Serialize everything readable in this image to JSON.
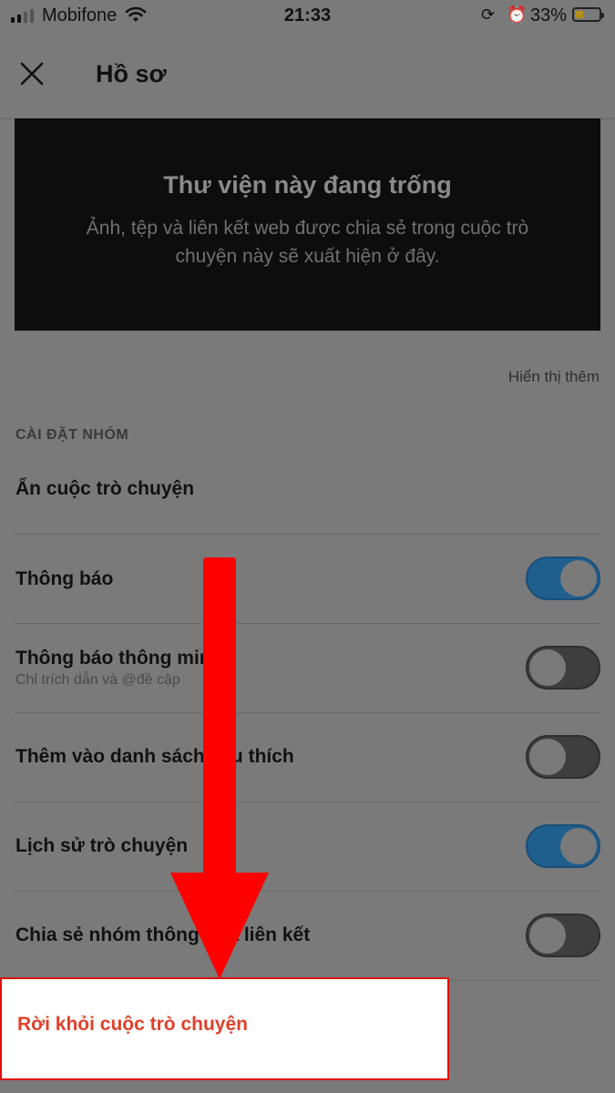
{
  "status_bar": {
    "carrier": "Mobifone",
    "time": "21:33",
    "battery_percent": "33%",
    "battery_level": 0.33
  },
  "header": {
    "title": "Hồ sơ"
  },
  "library": {
    "title": "Thư viện này đang trống",
    "description": "Ảnh, tệp và liên kết web được chia sẻ trong cuộc trò chuyện này sẽ xuất hiện ở đây."
  },
  "show_more": "Hiển thị thêm",
  "group_settings": {
    "section_title": "CÀI ĐẶT NHÓM",
    "hide_chat": "Ẩn cuộc trò chuyện",
    "items": [
      {
        "label": "Thông báo",
        "on": true
      },
      {
        "label": "Thông báo thông minh",
        "subtitle": "Chỉ trích dẫn và @đề cập",
        "on": false
      },
      {
        "label": "Thêm vào danh sách yêu thích",
        "on": false
      },
      {
        "label": "Lịch sử trò chuyện",
        "on": true
      },
      {
        "label": "Chia sẻ nhóm thông qua liên kết",
        "on": false
      }
    ]
  },
  "leave_chat": "Rời khỏi cuộc trò chuyện",
  "colors": {
    "overlay_background": "#7a7a7a",
    "toggle_on": "#1f5f8e",
    "toggle_off": "#3e3e3e",
    "leave_text": "#e0402a",
    "highlight_border": "#e10e0e",
    "annotation_arrow": "#ff0000"
  }
}
